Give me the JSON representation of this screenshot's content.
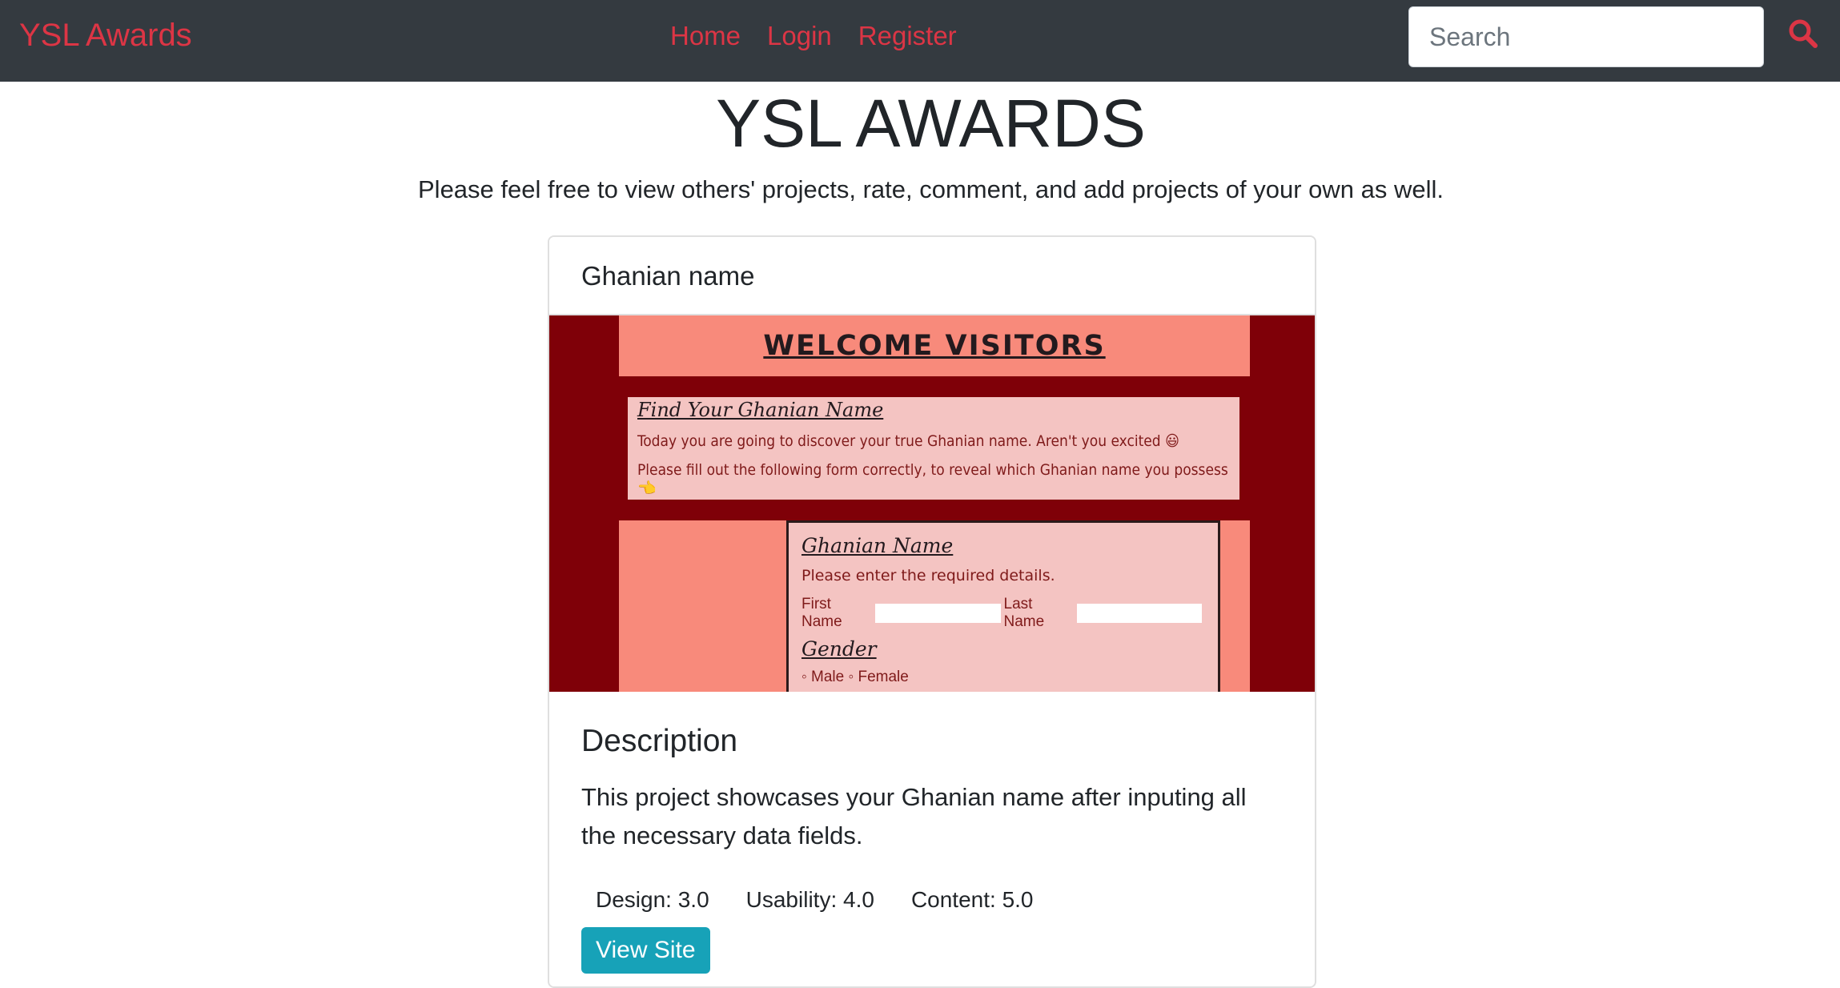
{
  "navbar": {
    "brand": "YSL Awards",
    "links": [
      "Home",
      "Login",
      "Register"
    ],
    "search_placeholder": "Search",
    "search_icon": "search-icon"
  },
  "hero": {
    "title": "YSL AWARDS",
    "subtitle": "Please feel free to view others' projects, rate, comment, and add projects of your own as well."
  },
  "project": {
    "title": "Ghanian name",
    "screenshot": {
      "welcome": "WELCOME VISITORS",
      "intro_title": "Find Your Ghanian Name",
      "intro_line1": "Today you are going to discover your true Ghanian name. Aren't you excited 😃",
      "intro_line2": "Please fill out the following form correctly, to reveal which Ghanian name you possess 👈",
      "form_title": "Ghanian Name",
      "form_prompt": "Please enter the required details.",
      "first_name_label": "First Name",
      "last_name_label": "Last Name",
      "gender_label": "Gender",
      "gender_options": "◦ Male ◦ Female"
    },
    "description_heading": "Description",
    "description": "This project showcases your Ghanian name after inputing all the necessary data fields.",
    "ratings": {
      "design": "Design: 3.0",
      "usability": "Usability: 4.0",
      "content": "Content: 5.0"
    },
    "view_button": "View Site"
  },
  "colors": {
    "navbar_bg": "#343a40",
    "accent": "#dc3545",
    "button": "#17a2b8"
  }
}
